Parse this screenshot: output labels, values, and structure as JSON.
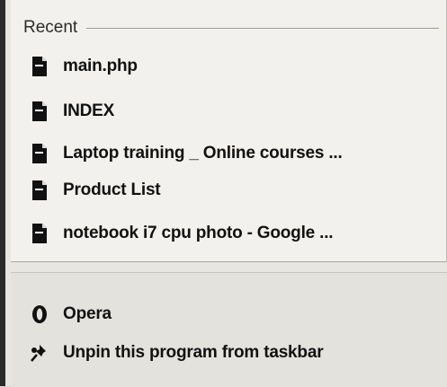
{
  "recent": {
    "header": "Recent",
    "items": [
      {
        "label": "main.php",
        "icon": "document-icon"
      },
      {
        "label": "INDEX",
        "icon": "document-icon"
      },
      {
        "label": "Laptop training _ Online courses ...",
        "icon": "document-icon"
      },
      {
        "label": "Product List",
        "icon": "document-icon"
      },
      {
        "label": "notebook i7 cpu photo - Google ...",
        "icon": "document-icon"
      }
    ]
  },
  "tasks": {
    "open_label": "Opera",
    "unpin_label": "Unpin this program from taskbar"
  },
  "colors": {
    "pane_top": "#f2f1ed",
    "pane_bottom": "#e4e2dd",
    "text": "#111111"
  }
}
